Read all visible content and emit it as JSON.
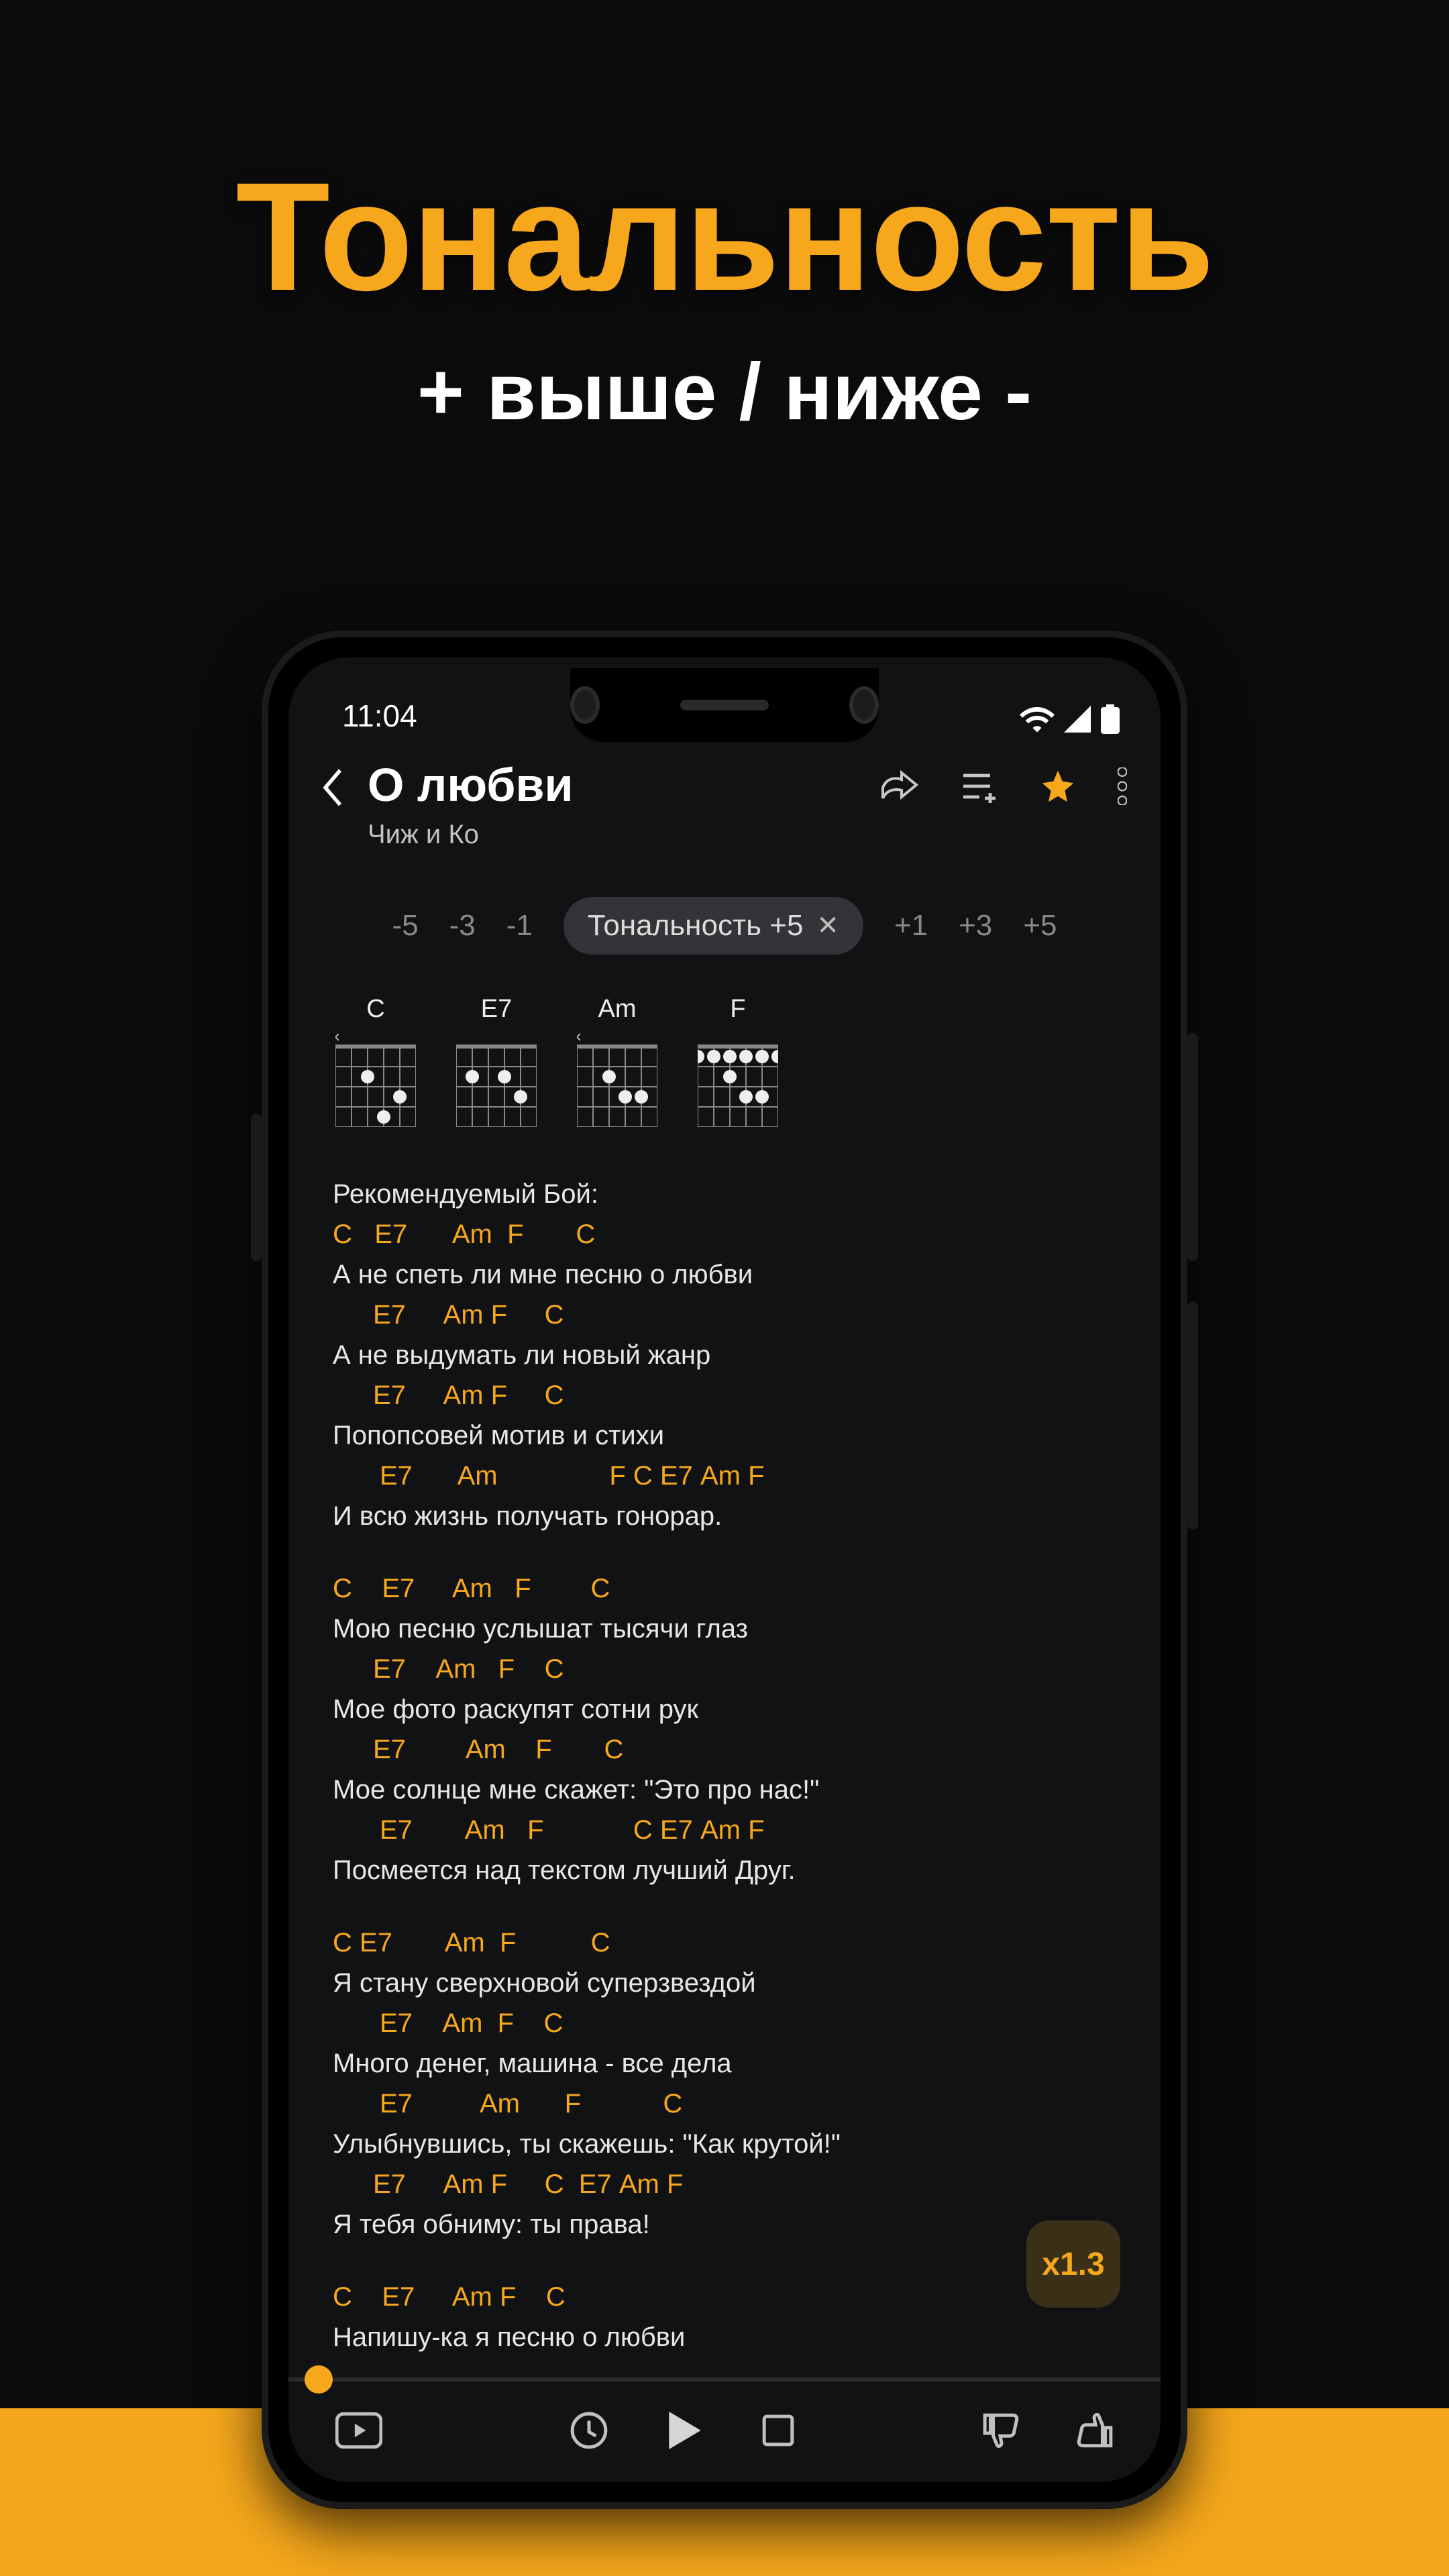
{
  "promo": {
    "title": "Тональность",
    "subtitle": "+ выше / ниже -"
  },
  "status": {
    "time": "11:04"
  },
  "header": {
    "song_title": "О любви",
    "artist": "Чиж и Ко"
  },
  "transpose": {
    "minus": [
      "-5",
      "-3",
      "-1"
    ],
    "chip": "Тональность +5",
    "plus": [
      "+1",
      "+3",
      "+5"
    ]
  },
  "chords": [
    {
      "name": "C",
      "top": [
        "x",
        "",
        "",
        "",
        "",
        ""
      ],
      "dots": [
        [
          2,
          1
        ],
        [
          3,
          3
        ],
        [
          4,
          2
        ]
      ]
    },
    {
      "name": "E7",
      "top": [
        "",
        "",
        "",
        "",
        "",
        ""
      ],
      "dots": [
        [
          1,
          1
        ],
        [
          3,
          1
        ],
        [
          4,
          2
        ]
      ]
    },
    {
      "name": "Am",
      "top": [
        "x",
        "",
        "",
        "",
        "",
        ""
      ],
      "dots": [
        [
          2,
          1
        ],
        [
          3,
          2
        ],
        [
          4,
          2
        ]
      ]
    },
    {
      "name": "F",
      "top": [
        "",
        "",
        "",
        "",
        "",
        ""
      ],
      "dots": [
        [
          0,
          0
        ],
        [
          1,
          0
        ],
        [
          2,
          0
        ],
        [
          3,
          0
        ],
        [
          4,
          0
        ],
        [
          5,
          0
        ],
        [
          3,
          2
        ],
        [
          4,
          2
        ],
        [
          2,
          1
        ]
      ]
    }
  ],
  "body": {
    "intro_label": "Рекомендуемый Бой:",
    "verses": [
      [
        {
          "chords": "C   E7      Am  F       C",
          "pad": ""
        },
        {
          "lyric": "А не спеть ли мне песню о любви"
        },
        {
          "chords": "E7     Am F     C",
          "pad": "pad1"
        },
        {
          "lyric": "А не выдумать ли новый жанр"
        },
        {
          "chords": "E7     Am F     C",
          "pad": "pad1"
        },
        {
          "lyric": "Попопсовей мотив и стихи"
        },
        {
          "chords": "E7      Am               F C E7 Am F",
          "pad": "pad2"
        },
        {
          "lyric": "И всю жизнь получать гонорар."
        }
      ],
      [
        {
          "chords": "C    E7     Am   F        C",
          "pad": ""
        },
        {
          "lyric": "Мою песню услышат тысячи глаз"
        },
        {
          "chords": "E7    Am   F    C",
          "pad": "pad1"
        },
        {
          "lyric": "Мое фото раскупят сотни рук"
        },
        {
          "chords": "E7        Am    F       C",
          "pad": "pad1"
        },
        {
          "lyric": "Мое солнце мне скажет: \"Это про нас!\""
        },
        {
          "chords": "E7       Am   F            C E7 Am F",
          "pad": "pad2"
        },
        {
          "lyric": "Посмеется над текстом лучший Друг."
        }
      ],
      [
        {
          "chords": "C E7       Am  F          C",
          "pad": ""
        },
        {
          "lyric": "Я стану сверхновой суперзвездой"
        },
        {
          "chords": "E7    Am  F    C",
          "pad": "pad2"
        },
        {
          "lyric": "Много денег, машина - все дела"
        },
        {
          "chords": "E7         Am      F           C",
          "pad": "pad2"
        },
        {
          "lyric": "Улыбнувшись, ты скажешь: \"Как крутой!\""
        },
        {
          "chords": "E7     Am F     C  E7 Am F",
          "pad": "pad1"
        },
        {
          "lyric": "Я тебя обниму: ты права!"
        }
      ],
      [
        {
          "chords": "C    E7     Am F    C",
          "pad": ""
        },
        {
          "lyric": "Напишу-ка я песню о любви"
        }
      ]
    ]
  },
  "speed": "x1.3"
}
